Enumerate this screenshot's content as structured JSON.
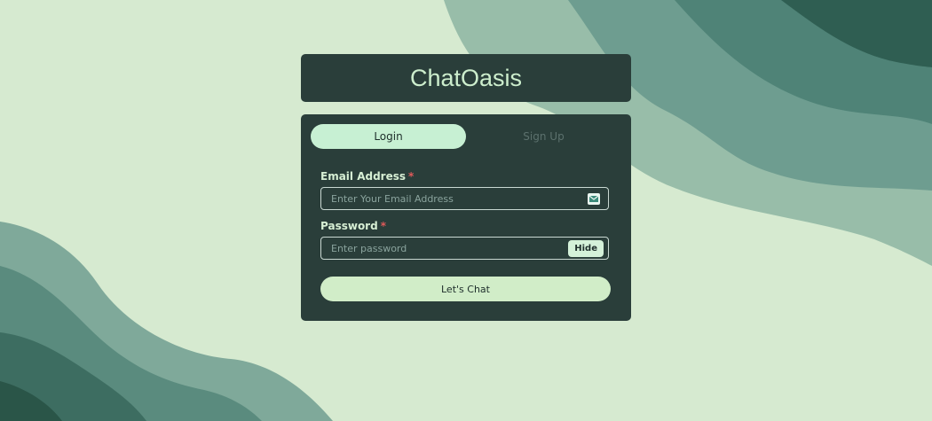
{
  "app": {
    "title": "ChatOasis"
  },
  "tabs": {
    "login_label": "Login",
    "signup_label": "Sign Up",
    "active": "login"
  },
  "form": {
    "email": {
      "label": "Email Address",
      "required_mark": "*",
      "placeholder": "Enter Your Email Address",
      "value": ""
    },
    "password": {
      "label": "Password",
      "required_mark": "*",
      "placeholder": "Enter password",
      "value": "",
      "toggle_label": "Hide"
    },
    "submit_label": "Let's Chat"
  },
  "icons": {
    "email_field_icon": "mail-icon"
  },
  "colors": {
    "card": "#2a3e3a",
    "title_text": "#cdeecd",
    "active_tab": "#c7f0d3",
    "submit_button": "#d1edc8",
    "required": "#e05a5a",
    "background": "#d6ead0"
  }
}
